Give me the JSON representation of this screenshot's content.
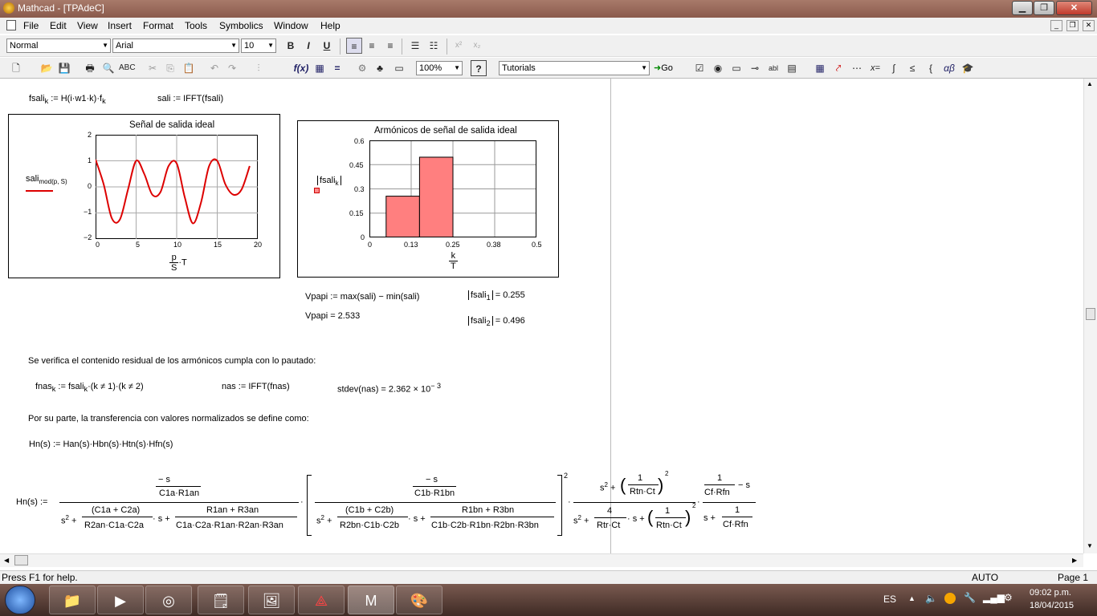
{
  "window": {
    "title": "Mathcad - [TPAdeC]",
    "min": "▁",
    "max": "❐",
    "close": "✕"
  },
  "menu": [
    "File",
    "Edit",
    "View",
    "Insert",
    "Format",
    "Tools",
    "Symbolics",
    "Window",
    "Help"
  ],
  "format_bar": {
    "style": "Normal",
    "font": "Arial",
    "size": "10",
    "bold": "B",
    "italic": "I",
    "underline": "U"
  },
  "std_bar": {
    "zoom": "100%",
    "resources": "Tutorials",
    "go": "Go"
  },
  "doc": {
    "line1_a": "fsali",
    "line1_a_sub": "k",
    "line1_b": " := H(i·w1·k)·f",
    "line1_b_sub": "k",
    "line1_c": "sali := IFFT(fsali)",
    "plot1": {
      "title": "Señal de salida ideal",
      "legend": "sali",
      "legend_sub": "mod(p, S)",
      "xlabel_num": "p",
      "xlabel_den": "S",
      "xlabel_tail": "·T",
      "yticks": [
        "2",
        "1",
        "0",
        "−1",
        "−2"
      ],
      "xticks": [
        "0",
        "5",
        "10",
        "15",
        "20"
      ]
    },
    "plot2": {
      "title": "Armónicos de señal de salida ideal",
      "legend": "fsali",
      "legend_sub": "k",
      "xlabel_num": "k",
      "xlabel_den": "T",
      "yticks": [
        "0.6",
        "0.45",
        "0.3",
        "0.15",
        "0"
      ],
      "xticks": [
        "0",
        "0.13",
        "0.25",
        "0.38",
        "0.5"
      ]
    },
    "vpapi_def": "Vpapi := max(sali) − min(sali)",
    "vpapi_res": "Vpapi = 2.533",
    "fs1_name": "fsali",
    "fs1_sub": "1",
    "fs1_val": "= 0.255",
    "fs2_name": "fsali",
    "fs2_sub": "2",
    "fs2_val": "= 0.496",
    "text1": "Se verifica el contenido residual de los armónicos cumpla con lo pautado:",
    "fnas_a": "fnas",
    "fnas_sub": "k",
    "fnas_b": " := fsali",
    "fnas_sub2": "k",
    "fnas_c": "·(k ≠ 1)·(k ≠ 2)",
    "nas": "nas := IFFT(fnas)",
    "stdev": "stdev(nas) = 2.362 × 10",
    "stdev_exp": "− 3",
    "text2": "Por su parte, la transferencia con valores normalizados se define como:",
    "hn_def": "Hn(s) := Han(s)·Hbn(s)·Htn(s)·Hfn(s)",
    "hn_lhs": "Hn(s) :=",
    "f1_num_num": "− s",
    "f1_num_den": "C1a·R1an",
    "f1_s2": "s",
    "f1_t1_num": "(C1a + C2a)",
    "f1_t1_den": "R2an·C1a·C2a",
    "f1_t2_num": "R1an + R3an",
    "f1_t2_den": "C1a·C2a·R1an·R2an·R3an",
    "f2_num_num": "− s",
    "f2_num_den": "C1b·R1bn",
    "f2_t1_num": "(C1b + C2b)",
    "f2_t1_den": "R2bn·C1b·C2b",
    "f2_t2_num": "R1bn + R3bn",
    "f2_t2_den": "C1b·C2b·R1bn·R2bn·R3bn",
    "f3_num_a": "1",
    "f3_num_b": "Rtn·Ct",
    "f3_den_a": "4",
    "f3_den_b": "Rtr·Ct",
    "f4_num_a": "1",
    "f4_num_b": "Cf·Rfn",
    "f4_den_b": "Cf·Rfn",
    "s_plus": "· s +",
    "minus_s": "− s",
    "s_plus_only": "s +",
    "sq": "2"
  },
  "status": {
    "help": "Press F1 for help.",
    "mode": "AUTO",
    "page": "Page 1"
  },
  "tray": {
    "lang": "ES",
    "time": "09:02 p.m.",
    "date": "18/04/2015"
  },
  "chart_data": [
    {
      "type": "line",
      "title": "Señal de salida ideal",
      "xlim": [
        0,
        20
      ],
      "ylim": [
        -2,
        2
      ],
      "series": [
        {
          "name": "sali",
          "x": [
            0,
            1,
            2,
            3,
            4,
            5,
            6,
            7,
            8,
            9,
            10,
            11,
            12,
            13,
            14,
            15,
            16,
            17,
            18,
            19
          ],
          "y": [
            1.05,
            0.1,
            -1.2,
            -1.25,
            -0.1,
            1.0,
            0.5,
            -0.3,
            -0.2,
            0.8,
            0.9,
            -0.4,
            -1.4,
            -0.6,
            0.8,
            1.0,
            0.1,
            -0.3,
            -0.1,
            0.8
          ]
        }
      ]
    },
    {
      "type": "bar",
      "title": "Armónicos de señal de salida ideal",
      "xlim": [
        0,
        0.5
      ],
      "ylim": [
        0,
        0.6
      ],
      "categories": [
        "0.05–0.15",
        "0.15–0.25"
      ],
      "values": [
        0.255,
        0.496
      ]
    }
  ]
}
